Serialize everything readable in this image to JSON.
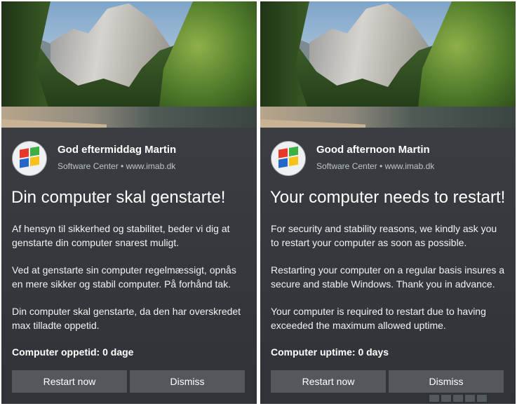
{
  "toasts": [
    {
      "greeting": "God eftermiddag Martin",
      "attribution": "Software Center • www.imab.dk",
      "title": "Din computer skal genstarte!",
      "paragraphs": [
        "Af hensyn til sikkerhed og stabilitet, beder vi dig at genstarte din computer snarest muligt.",
        "Ved at genstarte sin computer regelmæssigt, opnås en mere sikker og stabil computer. På forhånd tak.",
        "Din computer skal genstarte, da den har overskredet max tilladte oppetid."
      ],
      "uptime": "Computer oppetid: 0 dage",
      "buttons": {
        "primary": "Restart now",
        "secondary": "Dismiss"
      }
    },
    {
      "greeting": "Good afternoon Martin",
      "attribution": "Software Center • www.imab.dk",
      "title": "Your computer needs to restart!",
      "paragraphs": [
        "For security and stability reasons, we kindly ask you to restart your computer as soon as possible.",
        "Restarting your computer on a regular basis insures a secure and stable Windows. Thank you in advance.",
        "Your computer is required to restart due to having exceeded the maximum allowed uptime."
      ],
      "uptime": "Computer uptime: 0 days",
      "buttons": {
        "primary": "Restart now",
        "secondary": "Dismiss"
      }
    }
  ],
  "icons": {
    "hero": "mountain-landscape-image",
    "app_logo": "windows-flag-logo-icon"
  },
  "colors": {
    "toast_bg": "#363a3e",
    "button_bg": "#54585c",
    "text": "#ffffff",
    "secondary_text": "#bfc3c7"
  }
}
